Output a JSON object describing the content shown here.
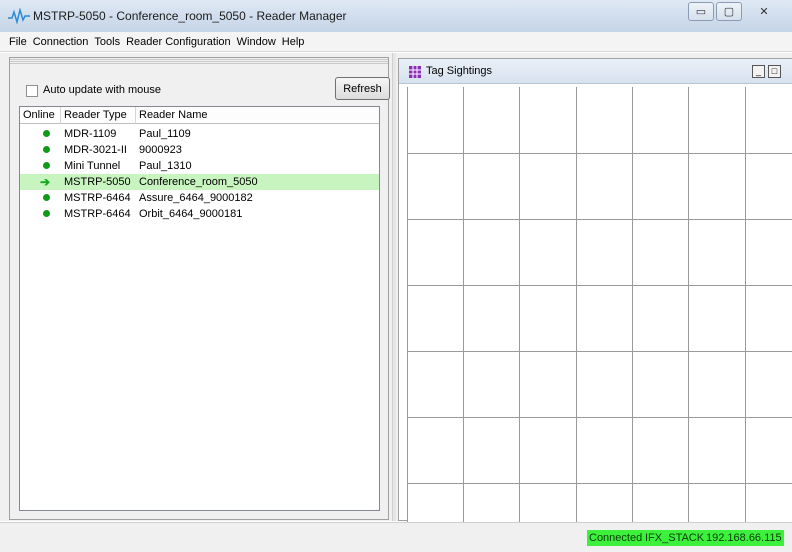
{
  "window": {
    "title": "MSTRP-5050 - Conference_room_5050 - Reader Manager",
    "minimize": "▭",
    "maximize": "▢",
    "close": "✕"
  },
  "menu": [
    "File",
    "Connection",
    "Tools",
    "Reader Configuration",
    "Window",
    "Help"
  ],
  "left_panel": {
    "auto_update_label": "Auto update with mouse",
    "auto_update_checked": false,
    "refresh_label": "Refresh",
    "columns": [
      "Online",
      "Reader Type",
      "Reader Name"
    ],
    "rows": [
      {
        "status": "online",
        "type": "MDR-1109",
        "name": "Paul_1109"
      },
      {
        "status": "online",
        "type": "MDR-3021-II",
        "name": "9000923"
      },
      {
        "status": "online",
        "type": "Mini Tunnel",
        "name": "Paul_1310"
      },
      {
        "status": "current",
        "type": "MSTRP-5050",
        "name": "Conference_room_5050"
      },
      {
        "status": "online",
        "type": "MSTRP-6464",
        "name": "Assure_6464_9000182"
      },
      {
        "status": "online",
        "type": "MSTRP-6464",
        "name": "Orbit_6464_9000181"
      }
    ]
  },
  "tag_window": {
    "title": "Tag Sightings",
    "minimize": "_",
    "maximize": "□"
  },
  "status": {
    "connection": "Connected",
    "stack": "IFX_STACK",
    "ip": "192.168.66.115"
  },
  "colors": {
    "online": "#0f9a1a",
    "selected_row": "#c8f4c0",
    "status_green": "#3cf03c"
  }
}
